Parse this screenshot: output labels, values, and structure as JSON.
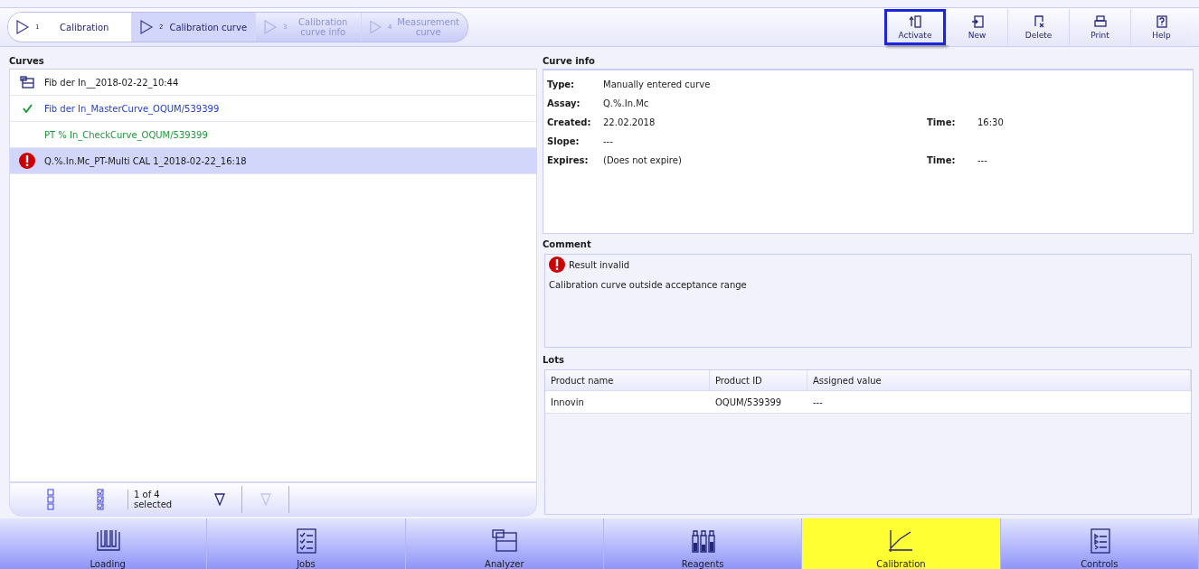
{
  "breadcrumb": [
    {
      "number": "1",
      "label": "Calibration",
      "selected": false,
      "disabled": false
    },
    {
      "number": "2",
      "label": "Calibration curve",
      "selected": true,
      "disabled": false
    },
    {
      "number": "3",
      "label": "Calibration curve info",
      "selected": false,
      "disabled": true
    },
    {
      "number": "4",
      "label": "Measurement curve",
      "selected": false,
      "disabled": true
    }
  ],
  "toolbar": [
    {
      "kind": "activate",
      "label": "Activate",
      "highlighted": true
    },
    {
      "kind": "new",
      "label": "New",
      "highlighted": false
    },
    {
      "kind": "delete",
      "label": "Delete",
      "highlighted": false
    },
    {
      "kind": "print",
      "label": "Print",
      "highlighted": false
    },
    {
      "kind": "help",
      "label": "Help",
      "highlighted": false
    }
  ],
  "curves": {
    "title": "Curves",
    "items": [
      {
        "kind": "analyzer",
        "name": "Fib der In__2018-02-22_10:44",
        "color": "#1a1a1a",
        "selected": false
      },
      {
        "kind": "check",
        "name": "Fib der In_MasterCurve_OQUM/539399",
        "color": "#1f3fd6",
        "selected": false
      },
      {
        "kind": "none",
        "name": "PT % In_CheckCurve_OQUM/539399",
        "color": "#1e9a3a",
        "selected": false
      },
      {
        "kind": "error",
        "name": "Q.%.In.Mc_PT-Multi CAL 1_2018-02-22_16:18",
        "color": "#1a1a1a",
        "selected": true
      }
    ],
    "footer": {
      "count": "1 of 4",
      "count_label": "selected"
    }
  },
  "curve_info": {
    "title": "Curve info",
    "fields": [
      {
        "label": "Type:",
        "value": "Manually entered curve"
      },
      {
        "label": "Assay:",
        "value": "Q.%.In.Mc"
      },
      {
        "label": "Created:",
        "value": "22.02.2018",
        "time_label": "Time:",
        "time": "16:30"
      },
      {
        "label": "Slope:",
        "value": "---"
      },
      {
        "label": "Expires:",
        "value": "(Does not expire)",
        "time_label": "Time:",
        "time": "---"
      }
    ]
  },
  "comment": {
    "title": "Comment",
    "status": "Result invalid",
    "text": "Calibration curve outside acceptance range"
  },
  "lots": {
    "title": "Lots",
    "columns": [
      "Product name",
      "Product ID",
      "Assigned value"
    ],
    "rows": [
      [
        "Innovin",
        "OQUM/539399",
        "---"
      ]
    ]
  },
  "nav": [
    {
      "kind": "loading",
      "label": "Loading",
      "selected": false
    },
    {
      "kind": "jobs",
      "label": "Jobs",
      "selected": false
    },
    {
      "kind": "analyzer",
      "label": "Analyzer",
      "selected": false
    },
    {
      "kind": "reagents",
      "label": "Reagents",
      "selected": false
    },
    {
      "kind": "calibration",
      "label": "Calibration",
      "selected": true
    },
    {
      "kind": "controls",
      "label": "Controls",
      "selected": false
    }
  ]
}
